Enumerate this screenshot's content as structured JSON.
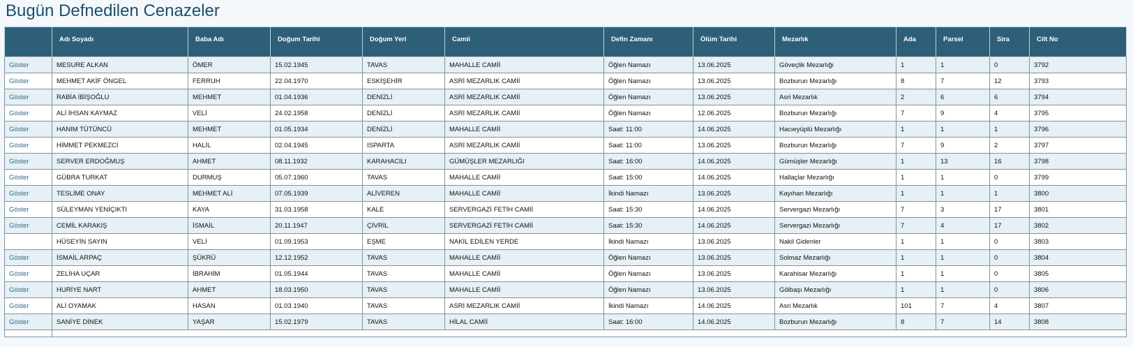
{
  "title": "Bugün Defnedilen Cenazeler",
  "columns": [
    "",
    "Adı Soyadı",
    "Baba Adı",
    "Doğum Tarihi",
    "Doğum Yeri",
    "Camii",
    "Defin Zamanı",
    "Ölüm Tarihi",
    "Mezarlık",
    "Ada",
    "Parsel",
    "Sira",
    "Cilt No"
  ],
  "link_label": "Göster",
  "rows": [
    {
      "link": "Göster",
      "cells": [
        "MESURE ALKAN",
        "ÖMER",
        "15.02.1945",
        "TAVAS",
        "MAHALLE CAMİİ",
        "Öğlen Namazı",
        "13.06.2025",
        "Göveçlik Mezarlığı",
        "1",
        "1",
        "0",
        "3792"
      ]
    },
    {
      "link": "Göster",
      "cells": [
        "MEHMET AKİF ÖNGEL",
        "FERRUH",
        "22.04.1970",
        "ESKİŞEHİR",
        "ASRİ MEZARLIK CAMİİ",
        "Öğlen Namazı",
        "13.06.2025",
        "Bozburun Mezarlığı",
        "8",
        "7",
        "12",
        "3793"
      ]
    },
    {
      "link": "Göster",
      "cells": [
        "RABİA İBİŞOĞLU",
        "MEHMET",
        "01.04.1936",
        "DENİZLİ",
        "ASRİ MEZARLIK CAMİİ",
        "Öğlen Namazı",
        "13.06.2025",
        "Asri Mezarlık",
        "2",
        "6",
        "6",
        "3794"
      ]
    },
    {
      "link": "Göster",
      "cells": [
        "ALİ İHSAN KAYMAZ",
        "VELİ",
        "24.02.1958",
        "DENİZLİ",
        "ASRİ MEZARLIK CAMİİ",
        "Öğlen Namazı",
        "12.06.2025",
        "Bozburun Mezarlığı",
        "7",
        "9",
        "4",
        "3795"
      ]
    },
    {
      "link": "Göster",
      "cells": [
        "HANIM TÜTÜNCÜ",
        "MEHMET",
        "01.05.1934",
        "DENİZLİ",
        "MAHALLE CAMİİ",
        "Saat: 11:00",
        "14.06.2025",
        "Hacıeyüplü Mezarlığı",
        "1",
        "1",
        "1",
        "3796"
      ]
    },
    {
      "link": "Göster",
      "cells": [
        "HİMMET PEKMEZCİ",
        "HALİL",
        "02.04.1945",
        "ISPARTA",
        "ASRİ MEZARLIK CAMİİ",
        "Saat: 11:00",
        "13.06.2025",
        "Bozburun Mezarlığı",
        "7",
        "9",
        "2",
        "3797"
      ]
    },
    {
      "link": "Göster",
      "cells": [
        "SERVER ERDOĞMUŞ",
        "AHMET",
        "08.11.1932",
        "KARAHACILI",
        "GÜMÜŞLER MEZARLIĞI",
        "Saat: 16:00",
        "14.06.2025",
        "Gümüşler Mezarlığı",
        "1",
        "13",
        "16",
        "3798"
      ]
    },
    {
      "link": "Göster",
      "cells": [
        "GÜBRA TURKAT",
        "DURMUŞ",
        "05.07.1960",
        "TAVAS",
        "MAHALLE CAMİİ",
        "Saat: 15:00",
        "14.06.2025",
        "Hallaçlar Mezarlığı",
        "1",
        "1",
        "0",
        "3799"
      ]
    },
    {
      "link": "Göster",
      "cells": [
        "TESLİME ONAY",
        "MEHMET ALİ",
        "07.05.1939",
        "ALİVEREN",
        "MAHALLE CAMİİ",
        "İkindi Namazı",
        "13.06.2025",
        "Kayıhan Mezarlığı",
        "1",
        "1",
        "1",
        "3800"
      ]
    },
    {
      "link": "Göster",
      "cells": [
        "SÜLEYMAN YENİÇIKTI",
        "KAYA",
        "31.03.1958",
        "KALE",
        "SERVERGAZİ FETİH CAMİİ",
        "Saat: 15:30",
        "14.06.2025",
        "Servergazi Mezarlığı",
        "7",
        "3",
        "17",
        "3801"
      ]
    },
    {
      "link": "Göster",
      "cells": [
        "CEMİL KARAKIŞ",
        "İSMAİL",
        "20.11.1947",
        "ÇİVRİL",
        "SERVERGAZİ FETİH CAMİİ",
        "Saat: 15:30",
        "14.06.2025",
        "Servergazi Mezarlığı",
        "7",
        "4",
        "17",
        "3802"
      ]
    },
    {
      "link": "",
      "cells": [
        "HÜSEYİN SAYIN",
        "VELİ",
        "01.09.1953",
        "EŞME",
        "NAKİL EDİLEN YERDE",
        "İkindi Namazı",
        "13.06.2025",
        "Nakil Gidenler",
        "1",
        "1",
        "0",
        "3803"
      ]
    },
    {
      "link": "Göster",
      "cells": [
        "İSMAİL ARPAÇ",
        "ŞÜKRÜ",
        "12.12.1952",
        "TAVAS",
        "MAHALLE CAMİİ",
        "Öğlen Namazı",
        "13.06.2025",
        "Solmaz Mezarlığı",
        "1",
        "1",
        "0",
        "3804"
      ]
    },
    {
      "link": "Göster",
      "cells": [
        "ZELİHA UÇAR",
        "İBRAHİM",
        "01.05.1944",
        "TAVAS",
        "MAHALLE CAMİİ",
        "Öğlen Namazı",
        "13.06.2025",
        "Karahisar Mezarlığı",
        "1",
        "1",
        "0",
        "3805"
      ]
    },
    {
      "link": "Göster",
      "cells": [
        "HURİYE NART",
        "AHMET",
        "18.03.1950",
        "TAVAS",
        "MAHALLE CAMİİ",
        "Öğlen Namazı",
        "13.06.2025",
        "Gölbaşı Mezarlığı",
        "1",
        "1",
        "0",
        "3806"
      ]
    },
    {
      "link": "Göster",
      "cells": [
        "ALİ OYAMAK",
        "HASAN",
        "01.03.1940",
        "TAVAS",
        "ASRİ MEZARLIK CAMİİ",
        "İkindi Namazı",
        "14.06.2025",
        "Asri Mezarlık",
        "101",
        "7",
        "4",
        "3807"
      ]
    },
    {
      "link": "Göster",
      "cells": [
        "SANİYE DİNEK",
        "YAŞAR",
        "15.02.1979",
        "TAVAS",
        "HİLAL CAMİİ",
        "Saat: 16:00",
        "14.06.2025",
        "Bozburun Mezarlığı",
        "8",
        "7",
        "14",
        "3808"
      ]
    }
  ],
  "colors": {
    "title": "#1c4f6e",
    "header_bg": "#2e5f78",
    "row_alt": "#e6f0f5",
    "link": "#2c6a88"
  }
}
